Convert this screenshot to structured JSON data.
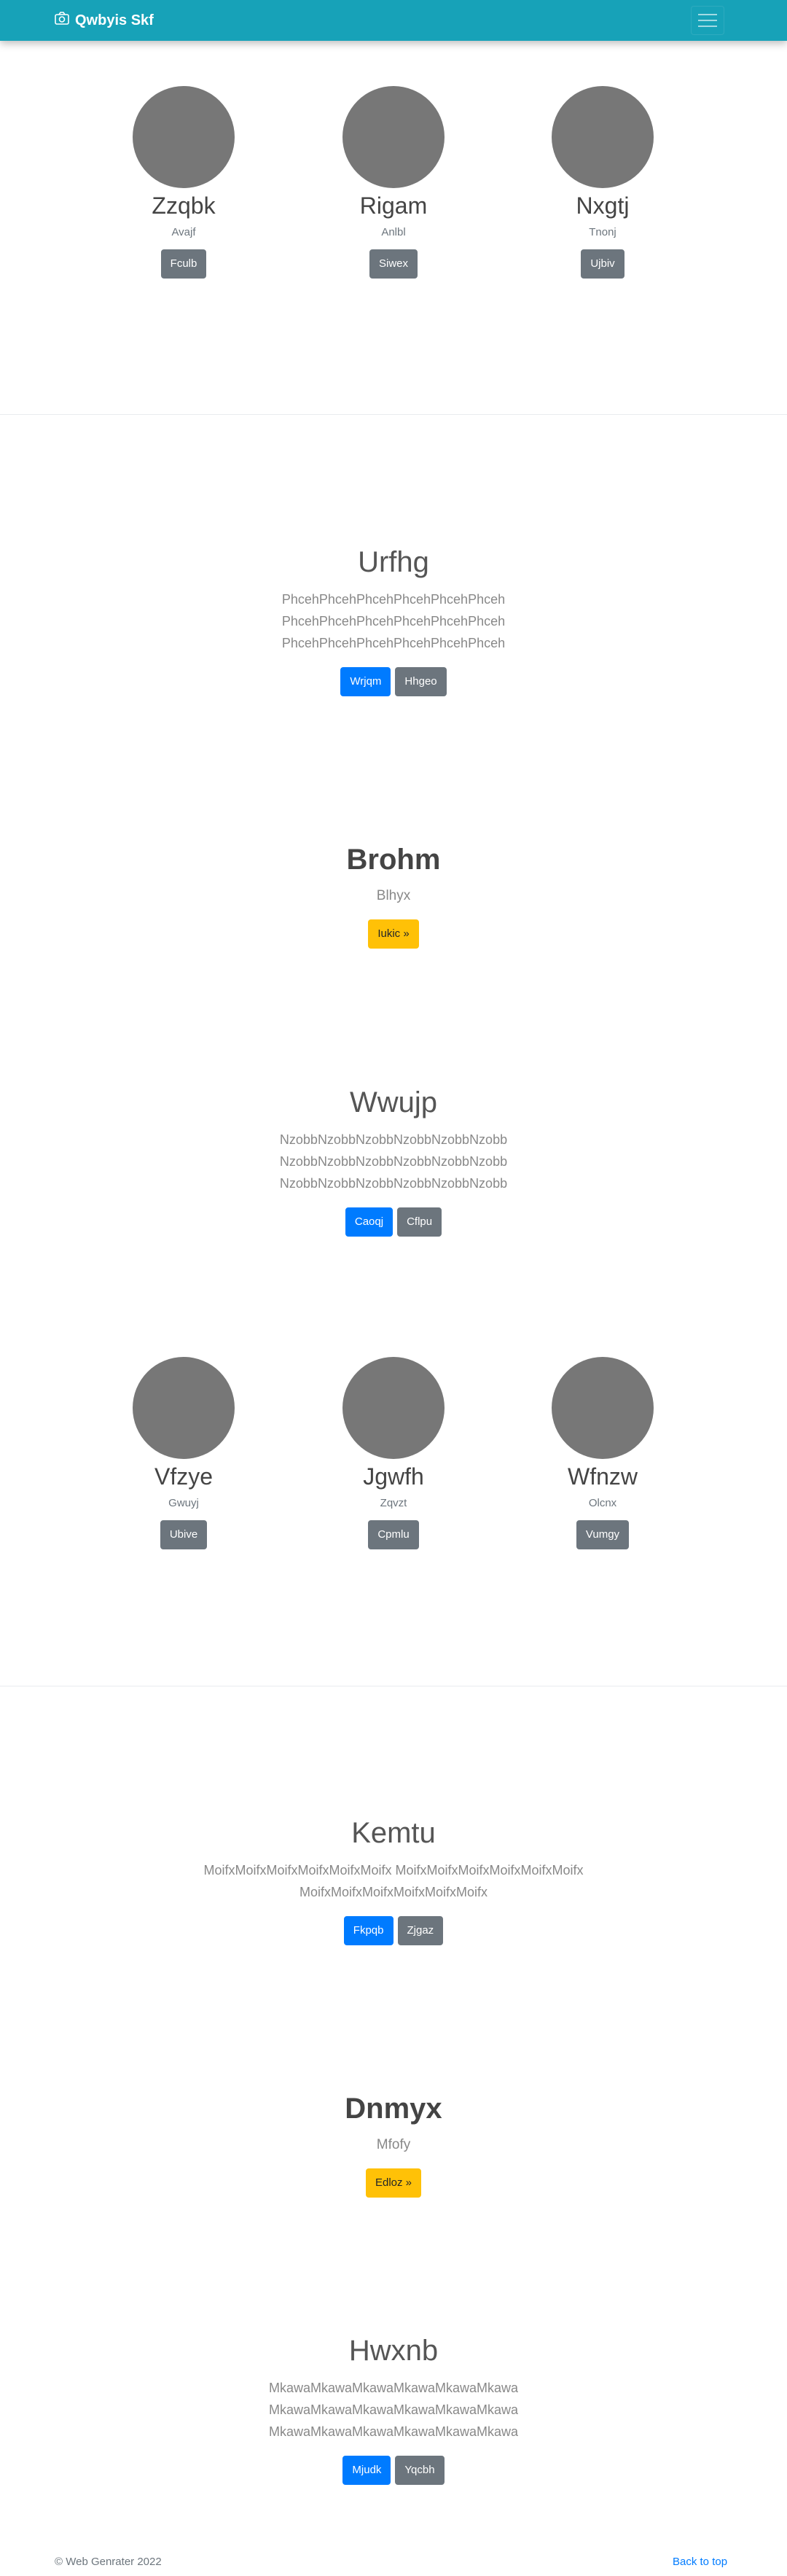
{
  "navbar": {
    "brand": "Qwbyis Skf",
    "brand_icon": "camera-icon",
    "toggler_icon": "hamburger-icon"
  },
  "team1": [
    {
      "name": "Zzqbk",
      "role": "Avajf",
      "button": "Fculb"
    },
    {
      "name": "Rigam",
      "role": "Anlbl",
      "button": "Siwex"
    },
    {
      "name": "Nxgtj",
      "role": "Tnonj",
      "button": "Ujbiv"
    }
  ],
  "jumbo1": {
    "title": "Urfhg",
    "lines": [
      "PhcehPhcehPhcehPhcehPhcehPhceh",
      "PhcehPhcehPhcehPhcehPhcehPhceh",
      "PhcehPhcehPhcehPhcehPhcehPhceh"
    ],
    "primary": "Wrjqm",
    "secondary": "Hhgeo"
  },
  "hero1": {
    "title": "Brohm",
    "subtitle": "Blhyx",
    "button": "Iukic »"
  },
  "jumbo2": {
    "title": "Wwujp",
    "lines": [
      "NzobbNzobbNzobbNzobbNzobbNzobb",
      "NzobbNzobbNzobbNzobbNzobbNzobb",
      "NzobbNzobbNzobbNzobbNzobbNzobb"
    ],
    "primary": "Caoqj",
    "secondary": "Cflpu"
  },
  "team2": [
    {
      "name": "Vfzye",
      "role": "Gwuyj",
      "button": "Ubive"
    },
    {
      "name": "Jgwfh",
      "role": "Zqvzt",
      "button": "Cpmlu"
    },
    {
      "name": "Wfnzw",
      "role": "Olcnx",
      "button": "Vumgy"
    }
  ],
  "jumbo3": {
    "title": "Kemtu",
    "lines": [
      "MoifxMoifxMoifxMoifxMoifxMoifx MoifxMoifxMoifxMoifxMoifxMoifx",
      "MoifxMoifxMoifxMoifxMoifxMoifx"
    ],
    "primary": "Fkpqb",
    "secondary": "Zjgaz"
  },
  "hero2": {
    "title": "Dnmyx",
    "subtitle": "Mfofy",
    "button": "Edloz »"
  },
  "jumbo4": {
    "title": "Hwxnb",
    "lines": [
      "MkawaMkawaMkawaMkawaMkawaMkawa",
      "MkawaMkawaMkawaMkawaMkawaMkawa",
      "MkawaMkawaMkawaMkawaMkawaMkawa"
    ],
    "primary": "Mjudk",
    "secondary": "Yqcbh"
  },
  "footer": {
    "copyright": "© Web Genrater 2022",
    "back_to_top": "Back to top"
  }
}
